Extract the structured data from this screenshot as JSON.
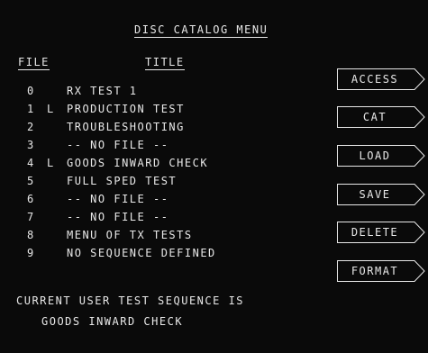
{
  "header": {
    "title": "DISC CATALOG MENU"
  },
  "columns": {
    "file": "FILE",
    "title": "TITLE"
  },
  "entries": [
    {
      "num": "0",
      "flag": "",
      "title": "RX TEST 1"
    },
    {
      "num": "1",
      "flag": "L",
      "title": "PRODUCTION TEST"
    },
    {
      "num": "2",
      "flag": "",
      "title": "TROUBLESHOOTING"
    },
    {
      "num": "3",
      "flag": "",
      "title": "-- NO FILE --"
    },
    {
      "num": "4",
      "flag": "L",
      "title": "GOODS INWARD CHECK"
    },
    {
      "num": "5",
      "flag": "",
      "title": "FULL SPED TEST"
    },
    {
      "num": "6",
      "flag": "",
      "title": "-- NO FILE --"
    },
    {
      "num": "7",
      "flag": "",
      "title": "-- NO FILE --"
    },
    {
      "num": "8",
      "flag": "",
      "title": "MENU OF TX TESTS"
    },
    {
      "num": "9",
      "flag": "",
      "title": "NO SEQUENCE DEFINED"
    }
  ],
  "softkeys": [
    {
      "label": "ACCESS"
    },
    {
      "label": "CAT"
    },
    {
      "label": "LOAD"
    },
    {
      "label": "SAVE"
    },
    {
      "label": "DELETE"
    },
    {
      "label": "FORMAT"
    }
  ],
  "status": {
    "line1": "CURRENT USER TEST SEQUENCE IS",
    "line2": "GOODS INWARD CHECK"
  }
}
